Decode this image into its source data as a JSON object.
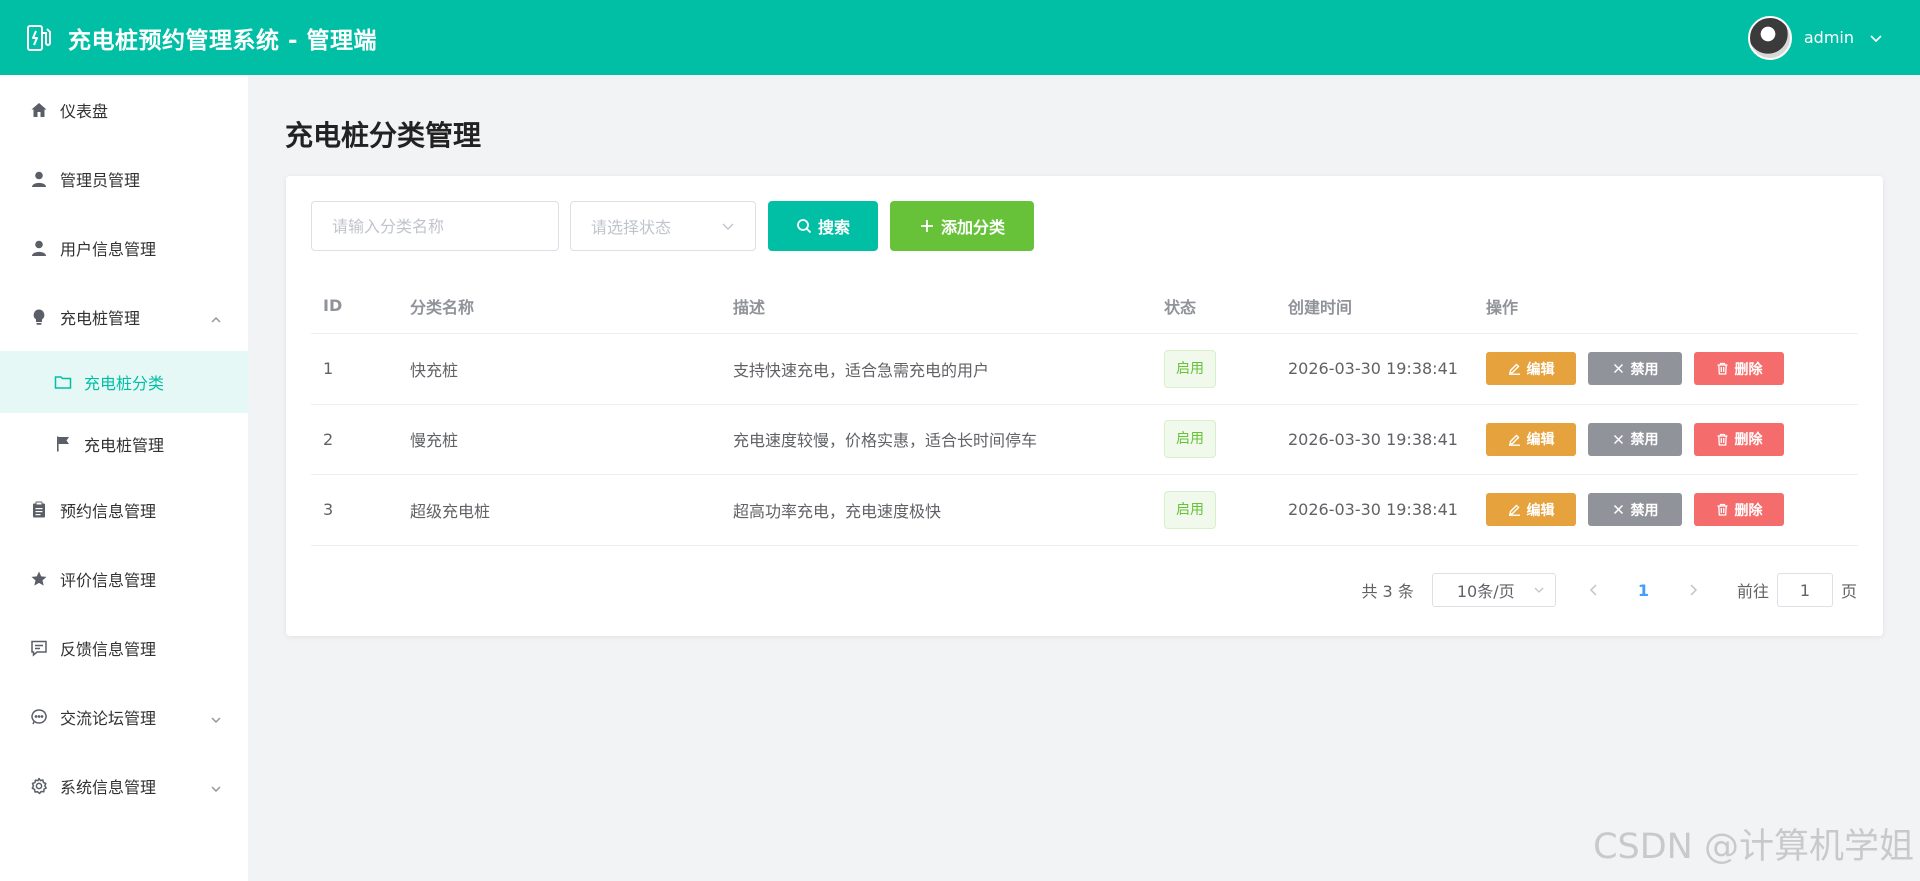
{
  "header": {
    "title": "充电桩预约管理系统 - 管理端",
    "user_name": "admin"
  },
  "sidebar": {
    "items": [
      {
        "label": "仪表盘",
        "icon": "home-icon"
      },
      {
        "label": "管理员管理",
        "icon": "user-icon"
      },
      {
        "label": "用户信息管理",
        "icon": "user-icon"
      },
      {
        "label": "充电桩管理",
        "icon": "bulb-icon",
        "expanded": true
      },
      {
        "label": "预约信息管理",
        "icon": "clipboard-icon"
      },
      {
        "label": "评价信息管理",
        "icon": "star-icon"
      },
      {
        "label": "反馈信息管理",
        "icon": "message-icon"
      },
      {
        "label": "交流论坛管理",
        "icon": "chat-icon"
      },
      {
        "label": "系统信息管理",
        "icon": "gear-icon"
      }
    ],
    "sub_items": [
      {
        "label": "充电桩分类",
        "icon": "folder-icon",
        "active": true
      },
      {
        "label": "充电桩管理",
        "icon": "flag-icon",
        "active": false
      }
    ]
  },
  "main": {
    "page_title": "充电桩分类管理",
    "search_placeholder": "请输入分类名称",
    "status_placeholder": "请选择状态",
    "search_label": "搜索",
    "add_label": "添加分类"
  },
  "table": {
    "headers": [
      "ID",
      "分类名称",
      "描述",
      "状态",
      "创建时间",
      "操作"
    ],
    "rows": [
      {
        "id": "1",
        "name": "快充桩",
        "desc": "支持快速充电，适合急需充电的用户",
        "status": "启用",
        "time": "2026-03-30 19:38:41"
      },
      {
        "id": "2",
        "name": "慢充桩",
        "desc": "充电速度较慢，价格实惠，适合长时间停车",
        "status": "启用",
        "time": "2026-03-30 19:38:41"
      },
      {
        "id": "3",
        "name": "超级充电桩",
        "desc": "超高功率充电，充电速度极快",
        "status": "启用",
        "time": "2026-03-30 19:38:41"
      }
    ],
    "actions": {
      "edit": "编辑",
      "disable": "禁用",
      "delete": "删除"
    }
  },
  "pagination": {
    "total": "共 3 条",
    "page_size": "10条/页",
    "current_page": "1",
    "goto_prefix": "前往",
    "goto_value": "1",
    "goto_suffix": "页"
  },
  "watermark": "CSDN @计算机学姐",
  "colors": {
    "primary": "#00bfa5",
    "success": "#67c23a",
    "warning": "#e6a23c",
    "info": "#909399",
    "danger": "#f56c6c"
  }
}
